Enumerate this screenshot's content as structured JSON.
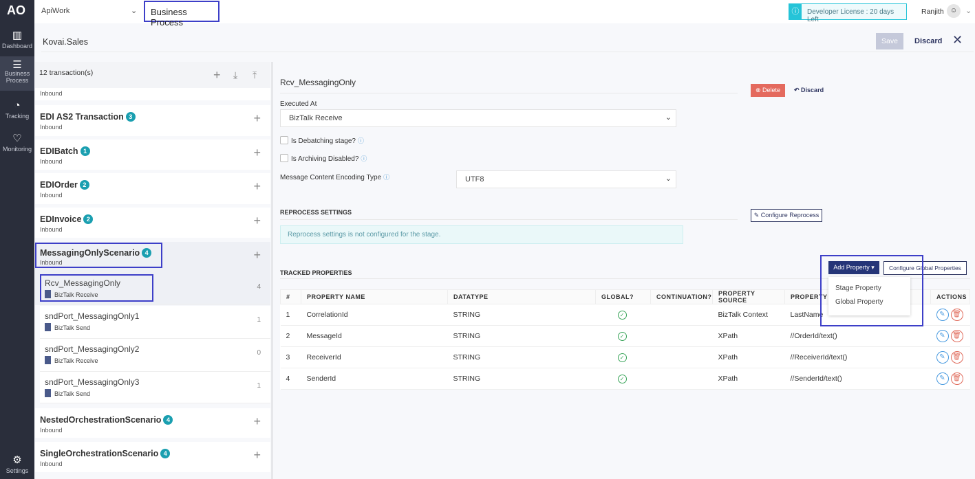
{
  "sidebar": {
    "items": [
      {
        "label": "Dashboard",
        "icon": "bar-chart-icon"
      },
      {
        "label": "Business Process",
        "icon": "list-icon"
      },
      {
        "label": "Tracking",
        "icon": "clock-icon"
      },
      {
        "label": "Monitoring",
        "icon": "heart-icon"
      },
      {
        "label": "Settings",
        "icon": "gear-icon"
      }
    ]
  },
  "header": {
    "workspace": "ApiWork",
    "title": "Business Process",
    "license": "Developer License : 20 days Left",
    "user": "Ranjith"
  },
  "page": {
    "title": "Kovai.Sales",
    "save": "Save",
    "discard": "Discard"
  },
  "list": {
    "count": "12 transaction(s)",
    "partial_sub": "Inbound",
    "transactions": [
      {
        "name": "EDI AS2 Transaction",
        "badge": "3",
        "dir": "Inbound"
      },
      {
        "name": "EDIBatch",
        "badge": "1",
        "dir": "Inbound"
      },
      {
        "name": "EDIOrder",
        "badge": "2",
        "dir": "Inbound"
      },
      {
        "name": "EDInvoice",
        "badge": "2",
        "dir": "Inbound"
      },
      {
        "name": "MessagingOnlyScenario",
        "badge": "4",
        "dir": "Inbound"
      },
      {
        "name": "NestedOrchestrationScenario",
        "badge": "4",
        "dir": "Inbound"
      },
      {
        "name": "SingleOrchestrationScenario",
        "badge": "4",
        "dir": "Inbound"
      }
    ],
    "stages": [
      {
        "name": "Rcv_MessagingOnly",
        "type": "BizTalk Receive",
        "count": "4"
      },
      {
        "name": "sndPort_MessagingOnly1",
        "type": "BizTalk Send",
        "count": "1"
      },
      {
        "name": "sndPort_MessagingOnly2",
        "type": "BizTalk Receive",
        "count": "0"
      },
      {
        "name": "sndPort_MessagingOnly3",
        "type": "BizTalk Send",
        "count": "1"
      }
    ]
  },
  "detail": {
    "stage_name": "Rcv_MessagingOnly",
    "delete": "Delete",
    "discard": "Discard",
    "executed_at_label": "Executed At",
    "executed_at": "BizTalk Receive",
    "debatching": "Is Debatching stage?",
    "archiving": "Is Archiving Disabled?",
    "encoding_label": "Message Content Encoding Type",
    "encoding": "UTF8",
    "reprocess_title": "REPROCESS SETTINGS",
    "configure_reprocess": "Configure Reprocess",
    "reprocess_msg": "Reprocess settings is not configured for the stage.",
    "tracked_title": "TRACKED PROPERTIES",
    "add_property": "Add Property",
    "configure_global": "Configure Global Properties",
    "menu": [
      "Stage Property",
      "Global Property"
    ],
    "columns": [
      "#",
      "PROPERTY NAME",
      "DATATYPE",
      "GLOBAL?",
      "CONTINUATION?",
      "PROPERTY SOURCE",
      "PROPERTY VA",
      "ACTIONS"
    ],
    "rows": [
      [
        "1",
        "CorrelationId",
        "STRING",
        "",
        "",
        "BizTalk Context",
        "LastName"
      ],
      [
        "2",
        "MessageId",
        "STRING",
        "",
        "",
        "XPath",
        "//OrderId/text()"
      ],
      [
        "3",
        "ReceiverId",
        "STRING",
        "",
        "",
        "XPath",
        "//ReceiverId/text()"
      ],
      [
        "4",
        "SenderId",
        "STRING",
        "",
        "",
        "XPath",
        "//SenderId/text()"
      ]
    ]
  }
}
